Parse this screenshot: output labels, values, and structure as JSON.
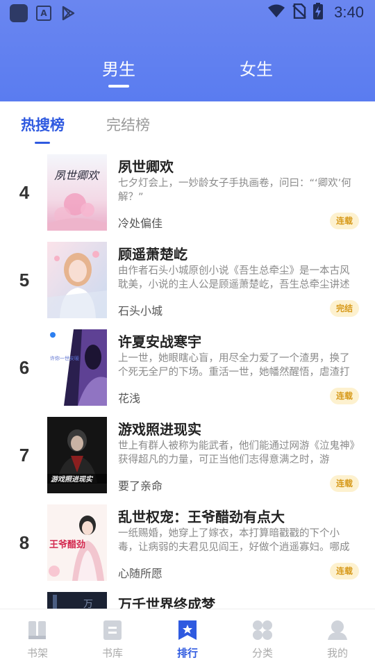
{
  "status_bar": {
    "time": "3:40"
  },
  "gender_tabs": [
    {
      "label": "男生",
      "selected": true
    },
    {
      "label": "女生",
      "selected": false
    }
  ],
  "rank_tabs": [
    {
      "label": "热搜榜",
      "selected": true
    },
    {
      "label": "完结榜",
      "selected": false
    }
  ],
  "books": [
    {
      "rank": "4",
      "title": "夙世卿欢",
      "description": "七夕灯会上，一妙龄女子手执画卷，问曰：“‘卿欢’何解？”",
      "author": "冷处偏佳",
      "status": "连载",
      "cover_text": "夙世卿欢"
    },
    {
      "rank": "5",
      "title": "顾遥萧楚屹",
      "description": "由作者石头小城原创小说《吾生总牵尘》是一本古风耽美，小说的主人公是顾遥萧楚屹，吾生总牵尘讲述",
      "author": "石头小城",
      "status": "完结"
    },
    {
      "rank": "6",
      "title": "许夏安战寒宇",
      "description": "上一世，她眼瞎心盲，用尽全力爱了一个渣男，换了个死无全尸的下场。重活一世，她幡然醒悟，虐渣打",
      "author": "花浅",
      "status": "连载",
      "cover_text": "许你一世安暖"
    },
    {
      "rank": "7",
      "title": "游戏照进现实",
      "description": "世上有群人被称为能武者，他们能通过网游《泣鬼神》获得超凡的力量，可正当他们志得意满之时，游",
      "author": "要了亲命",
      "status": "连载",
      "cover_text": "游戏照进现实"
    },
    {
      "rank": "8",
      "title": "乱世权宠：王爷醋劲有点大",
      "description": "一纸赐婚，她穿上了嫁衣，本打算暗戳戳的下个小毒，让病弱的夫君见见阎王，好做个逍遥寡妇。哪成",
      "author": "心随所愿",
      "status": "连载",
      "cover_text": "王爷醋劲"
    },
    {
      "rank": "",
      "title": "万千世界终成梦",
      "description": "",
      "author": "",
      "status": ""
    }
  ],
  "bottom_nav": [
    {
      "label": "书架",
      "icon": "bookshelf-icon",
      "active": false
    },
    {
      "label": "书库",
      "icon": "library-icon",
      "active": false
    },
    {
      "label": "排行",
      "icon": "ranking-icon",
      "active": true
    },
    {
      "label": "分类",
      "icon": "category-icon",
      "active": false
    },
    {
      "label": "我的",
      "icon": "profile-icon",
      "active": false
    }
  ],
  "colors": {
    "accent": "#2f5ae0",
    "header": "#5a7cf0",
    "badge_bg": "#fdf1cf",
    "badge_text": "#d79a1b"
  }
}
